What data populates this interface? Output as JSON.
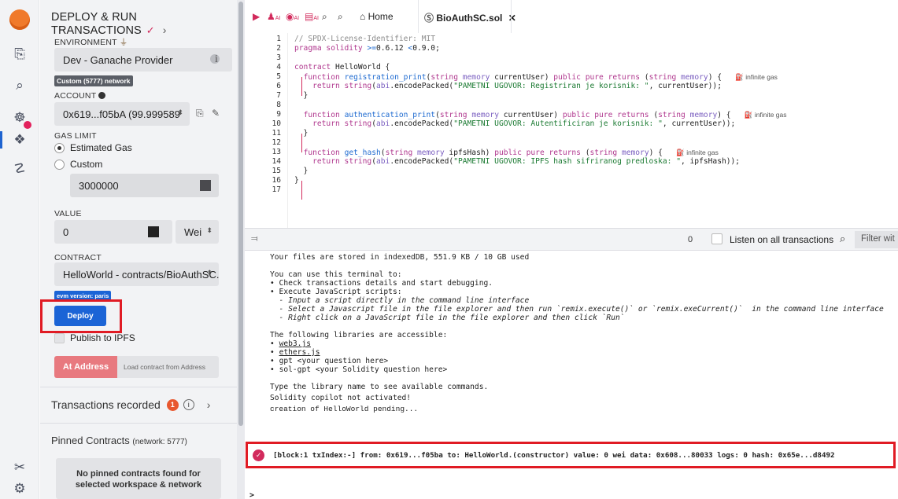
{
  "iconbar": {
    "items": [
      "logo",
      "file-explorer",
      "search",
      "solidity-compiler",
      "deploy-run",
      "debugger",
      "plugin-manager",
      "settings"
    ]
  },
  "panel": {
    "title": "DEPLOY & RUN TRANSACTIONS",
    "environment_label": "ENVIRONMENT",
    "environment_value": "Dev - Ganache Provider",
    "network_badge": "Custom (5777) network",
    "account_label": "ACCOUNT",
    "account_value": "0x619...f05bA (99.999589",
    "gas_limit_label": "GAS LIMIT",
    "gas_option_estimated": "Estimated Gas",
    "gas_option_custom": "Custom",
    "gas_value": "3000000",
    "value_label": "VALUE",
    "value_amount": "0",
    "value_unit": "Wei",
    "contract_label": "CONTRACT",
    "contract_value": "HelloWorld - contracts/BioAuthSC.s",
    "evm_badge": "evm version: paris",
    "deploy_label": "Deploy",
    "publish_label": "Publish to IPFS",
    "at_address_label": "At Address",
    "load_contract_placeholder": "Load contract from Address",
    "transactions_recorded_label": "Transactions recorded",
    "transactions_recorded_count": "1",
    "pinned_title": "Pinned Contracts",
    "pinned_network": "(network: 5777)",
    "pinned_empty_line1": "No pinned contracts found for",
    "pinned_empty_line2": "selected workspace & network"
  },
  "tabs": {
    "home_label": "Home",
    "file_label": "BioAuthSC.sol",
    "ai_label": "AI"
  },
  "editor": {
    "line_numbers": [
      "1",
      "2",
      "3",
      "4",
      "5",
      "6",
      "7",
      "8",
      "9",
      "10",
      "11",
      "12",
      "13",
      "14",
      "15",
      "16",
      "17"
    ],
    "gas_hint": "infinite gas"
  },
  "terminal": {
    "pending_count": "0",
    "listen_label": "Listen on all transactions",
    "filter_placeholder": "Filter wit",
    "storage_line": "Your files are stored in indexedDB, 551.9 KB / 10 GB used",
    "use_intro": "You can use this terminal to:",
    "use_1": "• Check transactions details and start debugging.",
    "use_2": "• Execute JavaScript scripts:",
    "use_2a": "  - Input a script directly in the command line interface",
    "use_2b": "  - Select a Javascript file in the file explorer and then run `remix.execute()` or `remix.exeCurrent()`  in the command line interface",
    "use_2c": "  - Right click on a JavaScript file in the file explorer and then click `Run`",
    "libs_intro": "The following libraries are accessible:",
    "lib_web3": "web3.js",
    "lib_ethers": "ethers.js",
    "lib_gpt": "gpt <your question here>",
    "lib_solgpt": "sol-gpt <your Solidity question here>",
    "type_lib": "Type the library name to see available commands.",
    "copilot": "Solidity copilot not activated!",
    "pending": "creation of HelloWorld pending...",
    "tx_line": "[block:1 txIndex:-] from: 0x619...f05ba to: HelloWorld.(constructor) value: 0 wei data: 0x608...80033 logs: 0 hash: 0x65e...d8492",
    "prompt": ">"
  },
  "colors": {
    "accent_blue": "#1e63d0",
    "deploy_blue": "#1b64d6",
    "highlight_red": "#e01b24",
    "badge_pink": "#d22a5c",
    "at_address_red": "#e8797f"
  }
}
